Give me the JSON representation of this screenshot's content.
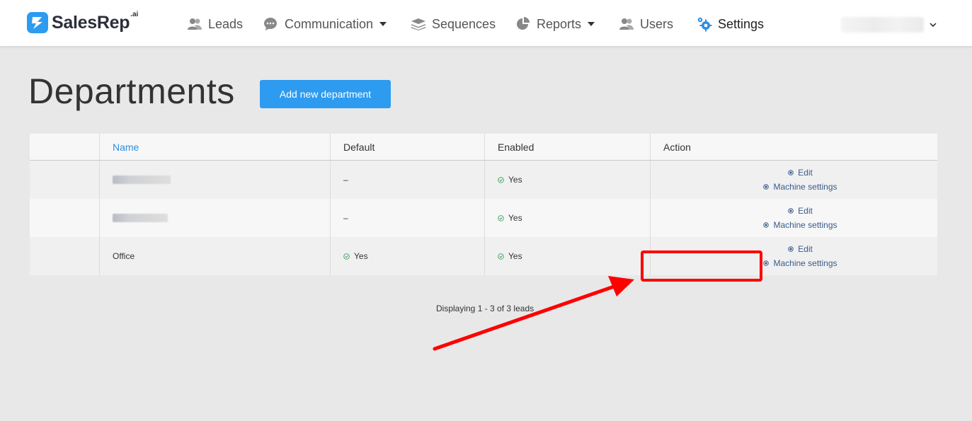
{
  "brand": {
    "name": "SalesRep",
    "suffix": ".ai"
  },
  "nav": [
    {
      "label": "Leads",
      "icon": "users-icon",
      "dropdown": false,
      "active": false
    },
    {
      "label": "Communication",
      "icon": "chat-icon",
      "dropdown": true,
      "active": false
    },
    {
      "label": "Sequences",
      "icon": "layers-icon",
      "dropdown": false,
      "active": false
    },
    {
      "label": "Reports",
      "icon": "pie-chart-icon",
      "dropdown": true,
      "active": false
    },
    {
      "label": "Users",
      "icon": "users-icon",
      "dropdown": false,
      "active": false
    },
    {
      "label": "Settings",
      "icon": "gears-icon",
      "dropdown": false,
      "active": true
    }
  ],
  "page": {
    "title": "Departments",
    "add_button": "Add new department"
  },
  "table": {
    "columns": [
      "Name",
      "Default",
      "Enabled",
      "Action"
    ],
    "rows": [
      {
        "name": "",
        "default": "–",
        "enabled": "Yes",
        "actions": [
          "Edit",
          "Machine settings"
        ]
      },
      {
        "name": "",
        "default": "–",
        "enabled": "Yes",
        "actions": [
          "Edit",
          "Machine settings"
        ]
      },
      {
        "name": "Office",
        "default": "Yes",
        "enabled": "Yes",
        "actions": [
          "Edit",
          "Machine settings"
        ]
      }
    ]
  },
  "footer": {
    "prefix": "Displaying ",
    "range": "1 - 3",
    "of": " of ",
    "total": "3",
    "suffix": " leads"
  },
  "colors": {
    "accent": "#2d9bf0",
    "annotation": "#ff0000",
    "check": "#3aa35a"
  }
}
